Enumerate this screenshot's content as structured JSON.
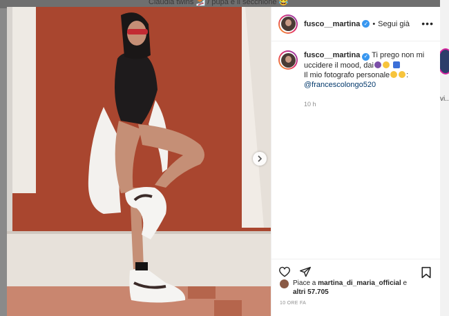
{
  "background": {
    "top_caption": "Claudia twins 🏂 / pupa e il secchione 😂",
    "right_peek_text": "vi..."
  },
  "post": {
    "username": "fusco__martina",
    "verified": true,
    "follow_label": "Segui già",
    "separator": "•",
    "more_label": "•••",
    "caption": {
      "username": "fusco__martina",
      "line1": "Ti prego non mi uccidere il mood, dai",
      "line2": "Il mio fotografo personale",
      "mention": "@francescolongo520"
    },
    "caption_time": "10 h",
    "likes": {
      "prefix": "Piace a",
      "user": "martina_di_maria_official",
      "middle": "e",
      "others": "altri 57.705"
    },
    "posted_ago": "10 ORE FA",
    "icons": {
      "like": "heart-icon",
      "share": "share-icon",
      "save": "bookmark-icon",
      "next": "chevron-right-icon",
      "more": "more-options-icon"
    },
    "colors": {
      "wall": "#a9462f",
      "accent_blue": "#3897f0",
      "mention": "#00376b"
    }
  }
}
